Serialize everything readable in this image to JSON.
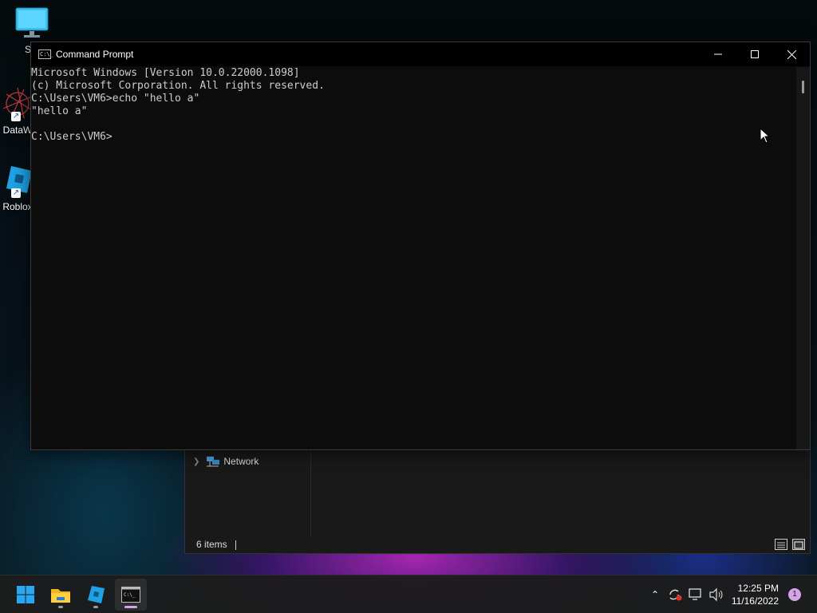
{
  "desktop": {
    "icons": [
      {
        "label": "Sta"
      },
      {
        "label": "DataW"
      },
      {
        "label": "Roblox"
      }
    ]
  },
  "explorer": {
    "nav_network_label": "Network",
    "status_items": "6 items"
  },
  "cmd": {
    "title": "Command Prompt",
    "title_icon_text": "C:\\_",
    "lines": [
      "Microsoft Windows [Version 10.0.22000.1098]",
      "(c) Microsoft Corporation. All rights reserved.",
      "C:\\Users\\VM6>echo \"hello a\"",
      "\"hello a\"",
      "",
      "C:\\Users\\VM6>"
    ]
  },
  "taskbar": {
    "apps": [
      {
        "name": "start",
        "icon": "windows-logo-icon"
      },
      {
        "name": "file-explorer",
        "icon": "folder-icon"
      },
      {
        "name": "roblox-studio",
        "icon": "roblox-studio-icon"
      },
      {
        "name": "command-prompt",
        "icon": "terminal-icon"
      }
    ],
    "tray": {
      "time": "12:25 PM",
      "date": "11/16/2022",
      "notification_count": "1"
    }
  },
  "colors": {
    "console_text": "#cccccc",
    "console_bg": "#0c0c0c",
    "accent_indicator": "#d7a3e8"
  }
}
